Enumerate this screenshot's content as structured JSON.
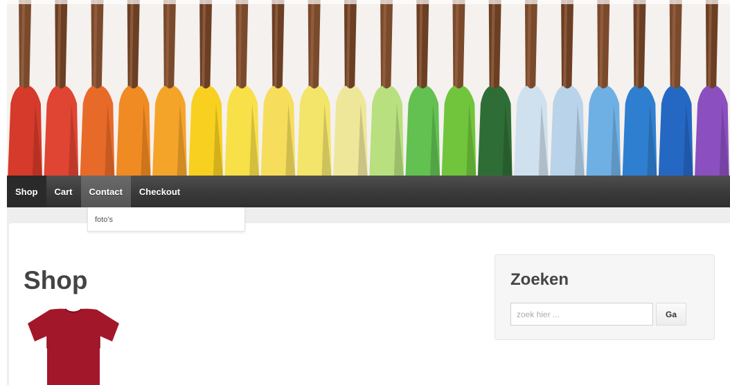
{
  "nav": {
    "items": [
      {
        "label": "Shop"
      },
      {
        "label": "Cart"
      },
      {
        "label": "Contact"
      },
      {
        "label": "Checkout"
      }
    ],
    "dropdown": {
      "items": [
        {
          "label": "foto's"
        }
      ]
    }
  },
  "main": {
    "title": "Shop"
  },
  "sidebar": {
    "search": {
      "title": "Zoeken",
      "placeholder": "zoek hier ...",
      "button_label": "Ga"
    }
  },
  "colors": {
    "navbar": "#3a3a3a",
    "heading": "#444444",
    "product_shirt": "#a3172a"
  }
}
